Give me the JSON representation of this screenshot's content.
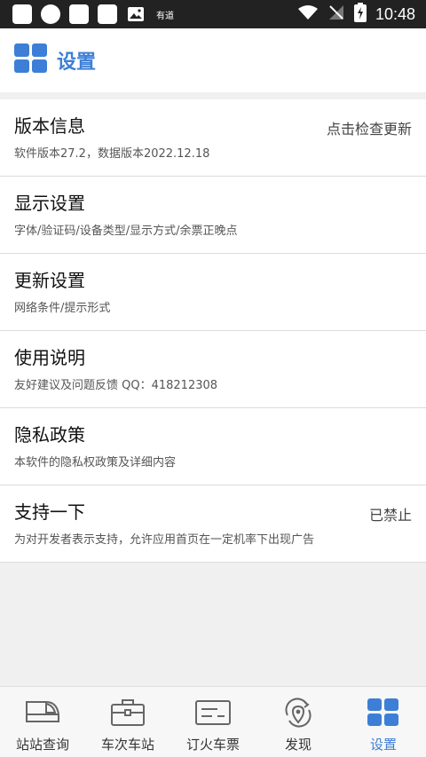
{
  "status_bar": {
    "app_label": "有道",
    "time": "10:48"
  },
  "header": {
    "title": "设置",
    "icon": "grid-icon"
  },
  "settings": [
    {
      "title": "版本信息",
      "subtitle": "软件版本27.2，数据版本2022.12.18",
      "right": "点击检查更新"
    },
    {
      "title": "显示设置",
      "subtitle": "字体/验证码/设备类型/显示方式/余票正晚点",
      "right": ""
    },
    {
      "title": "更新设置",
      "subtitle": "网络条件/提示形式",
      "right": ""
    },
    {
      "title": "使用说明",
      "subtitle": "友好建议及问题反馈 QQ：418212308",
      "right": ""
    },
    {
      "title": "隐私政策",
      "subtitle": "本软件的隐私权政策及详细内容",
      "right": ""
    },
    {
      "title": "支持一下",
      "subtitle": "为对开发者表示支持，允许应用首页在一定机率下出现广告",
      "right": "已禁止"
    }
  ],
  "tabs": [
    {
      "label": "站站查询",
      "icon": "train-icon"
    },
    {
      "label": "车次车站",
      "icon": "briefcase-icon"
    },
    {
      "label": "订火车票",
      "icon": "ticket-icon"
    },
    {
      "label": "发现",
      "icon": "location-refresh-icon"
    },
    {
      "label": "设置",
      "icon": "grid-icon",
      "active": true
    }
  ],
  "colors": {
    "accent": "#3d7fd6",
    "status_bar_bg": "#222222",
    "background": "#f0f0f0"
  }
}
